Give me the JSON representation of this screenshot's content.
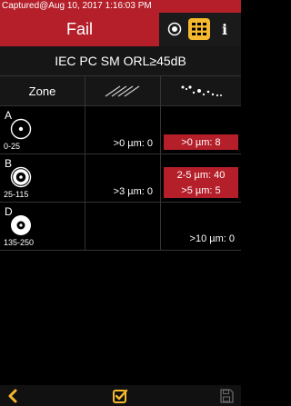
{
  "capture_text": "Captured@Aug 10, 2017 1:16:03 PM",
  "status": "Fail",
  "standard": "IEC PC SM ORL≥45dB",
  "headers": {
    "zone": "Zone",
    "scratch_icon": "scratch-icon",
    "defect_icon": "defect-icon"
  },
  "zones": [
    {
      "letter": "A",
      "range": "0-25",
      "scratch": ">0 µm: 0",
      "defects": [
        {
          "text": ">0 µm: 8",
          "fail": true
        }
      ]
    },
    {
      "letter": "B",
      "range": "25-115",
      "scratch": ">3 µm: 0",
      "defects": [
        {
          "text": "2-5 µm: 40",
          "fail": true
        },
        {
          "text": ">5 µm: 5",
          "fail": true
        }
      ]
    },
    {
      "letter": "D",
      "range": "135-250",
      "scratch": "",
      "defects": [
        {
          "text": ">10 µm: 0",
          "fail": false
        }
      ]
    }
  ],
  "colors": {
    "fail_red": "#b41f2a",
    "accent_yellow": "#f5b82e"
  },
  "toolbar": {
    "back_icon": "chevron-left-icon",
    "check_icon": "checkbox-icon",
    "save_icon": "save-icon"
  }
}
